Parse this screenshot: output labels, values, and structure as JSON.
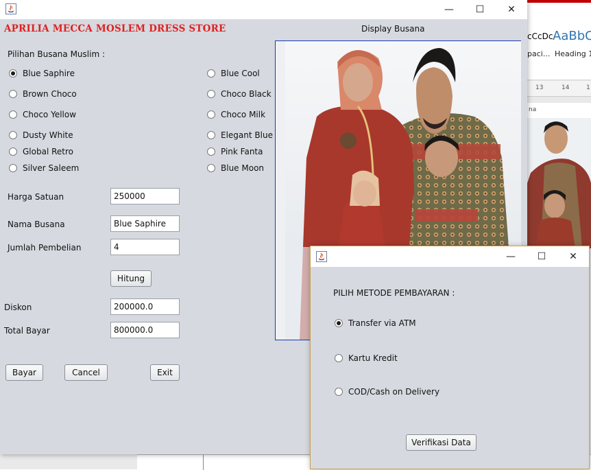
{
  "background_app": {
    "styles": [
      {
        "sample": "cCcDc",
        "name": "paci..."
      },
      {
        "sample": "AaBbC",
        "name": "Heading 1"
      }
    ],
    "ruler_ticks": [
      "13",
      "14",
      "1"
    ],
    "nav_text": "na"
  },
  "main_window": {
    "store_title": "APRILIA MECCA MOSLEM DRESS STORE",
    "display_label": "Display Busana",
    "section_label": "Pilihan Busana Muslim :",
    "options_left": [
      {
        "label": "Blue Saphire",
        "checked": true
      },
      {
        "label": "Brown Choco",
        "checked": false
      },
      {
        "label": "Choco Yellow",
        "checked": false
      },
      {
        "label": "Dusty White",
        "checked": false
      },
      {
        "label": "Global Retro",
        "checked": false
      },
      {
        "label": "Silver Saleem",
        "checked": false
      }
    ],
    "options_right": [
      {
        "label": "Blue Cool",
        "checked": false
      },
      {
        "label": "Choco Black",
        "checked": false
      },
      {
        "label": "Choco Milk",
        "checked": false
      },
      {
        "label": "Elegant Blue",
        "checked": false
      },
      {
        "label": "Pink Fanta",
        "checked": false
      },
      {
        "label": "Blue Moon",
        "checked": false
      }
    ],
    "fields": {
      "harga_label": "Harga Satuan",
      "harga_value": "250000",
      "nama_label": "Nama Busana",
      "nama_value": "Blue Saphire",
      "jumlah_label": "Jumlah Pembelian",
      "jumlah_value": "4",
      "diskon_label": "Diskon",
      "diskon_value": "200000.0",
      "total_label": "Total Bayar",
      "total_value": "800000.0"
    },
    "buttons": {
      "hitung": "Hitung",
      "bayar": "Bayar",
      "cancel": "Cancel",
      "exit": "Exit"
    },
    "window_controls": {
      "minimize": "—",
      "maximize": "☐",
      "close": "✕"
    }
  },
  "payment_dialog": {
    "heading": "PILIH METODE PEMBAYARAN :",
    "options": [
      {
        "label": "Transfer via ATM",
        "checked": true
      },
      {
        "label": "Kartu Kredit",
        "checked": false
      },
      {
        "label": "COD/Cash on Delivery",
        "checked": false
      }
    ],
    "verify_button": "Verifikasi Data",
    "window_controls": {
      "minimize": "—",
      "maximize": "☐",
      "close": "✕"
    }
  },
  "colors": {
    "title_red": "#e02020",
    "panel_bg": "#d6d9df",
    "display_border": "#1a3bb0"
  }
}
